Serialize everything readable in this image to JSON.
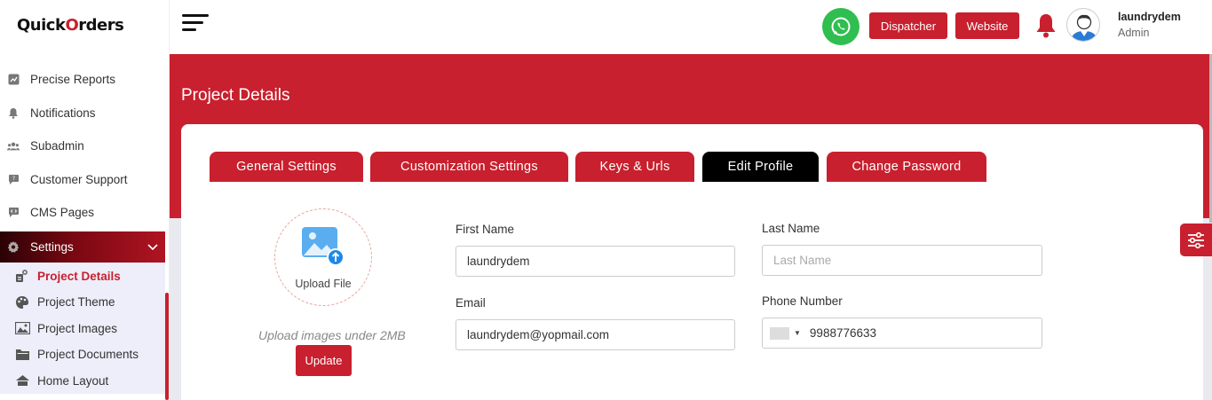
{
  "brand": {
    "logo_pre": "Quick",
    "logo_o": "O",
    "logo_post": "rders"
  },
  "sidebar": {
    "items": [
      {
        "label": "Precise Reports",
        "icon": "chart-icon"
      },
      {
        "label": "Notifications",
        "icon": "bell-icon"
      },
      {
        "label": "Subadmin",
        "icon": "users-icon"
      },
      {
        "label": "Customer Support",
        "icon": "chat-icon"
      },
      {
        "label": "CMS Pages",
        "icon": "code-icon"
      }
    ],
    "settings": {
      "label": "Settings",
      "icon": "gear-icon",
      "expanded": true
    },
    "sub_items": [
      {
        "label": "Project Details",
        "icon": "project-details-icon",
        "current": true
      },
      {
        "label": "Project Theme",
        "icon": "palette-icon"
      },
      {
        "label": "Project Images",
        "icon": "image-icon"
      },
      {
        "label": "Project Documents",
        "icon": "documents-icon"
      },
      {
        "label": "Home Layout",
        "icon": "home-icon"
      }
    ]
  },
  "header": {
    "dispatcher_label": "Dispatcher",
    "website_label": "Website",
    "user_name": "laundrydem",
    "user_role": "Admin"
  },
  "page": {
    "title": "Project Details"
  },
  "tabs": [
    {
      "label": "General Settings",
      "selected": false
    },
    {
      "label": "Customization Settings",
      "selected": false
    },
    {
      "label": "Keys & Urls",
      "selected": false
    },
    {
      "label": "Edit Profile",
      "selected": true
    },
    {
      "label": "Change Password",
      "selected": false
    }
  ],
  "profile": {
    "upload_label": "Upload File",
    "upload_note": "Upload images under 2MB",
    "update_label": "Update",
    "first_name_label": "First Name",
    "first_name_value": "laundrydem",
    "last_name_label": "Last Name",
    "last_name_placeholder": "Last Name",
    "email_label": "Email",
    "email_value": "laundrydem@yopmail.com",
    "phone_label": "Phone Number",
    "phone_value": "9988776633"
  },
  "colors": {
    "primary": "#c8202e",
    "active_tab": "#000000",
    "whatsapp": "#2fbe4f"
  }
}
